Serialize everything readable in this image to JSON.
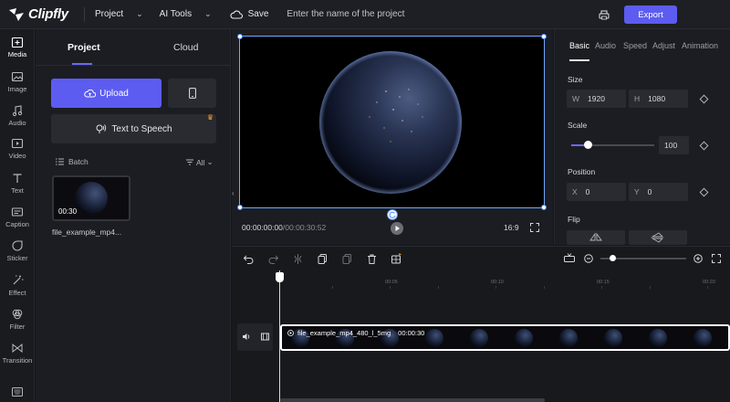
{
  "app": {
    "logo_text": "Clipfly",
    "project_menu": "Project",
    "ai_tools_menu": "AI Tools",
    "save_label": "Save",
    "project_name_placeholder": "Enter the name of the project",
    "export_label": "Export"
  },
  "rail": {
    "items": [
      {
        "label": "Media",
        "icon": "media-icon"
      },
      {
        "label": "Image",
        "icon": "image-icon"
      },
      {
        "label": "Audio",
        "icon": "music-icon"
      },
      {
        "label": "Video",
        "icon": "video-icon"
      },
      {
        "label": "Text",
        "icon": "text-icon"
      },
      {
        "label": "Caption",
        "icon": "caption-icon"
      },
      {
        "label": "Sticker",
        "icon": "sticker-icon"
      },
      {
        "label": "Effect",
        "icon": "effect-icon"
      },
      {
        "label": "Filter",
        "icon": "filter-icon"
      },
      {
        "label": "Transition",
        "icon": "transition-icon"
      }
    ]
  },
  "media": {
    "tab_project": "Project",
    "tab_cloud": "Cloud",
    "upload_label": "Upload",
    "tts_label": "Text to Speech",
    "batch_label": "Batch",
    "filter_label": "All",
    "item": {
      "duration": "00:30",
      "name": "file_example_mp4..."
    }
  },
  "preview": {
    "current_time": "00:00:00:00",
    "separator": "/",
    "total_time": "00:00:30:52",
    "aspect_ratio": "16:9"
  },
  "properties": {
    "tabs": [
      "Basic",
      "Audio",
      "Speed",
      "Adjust",
      "Animation"
    ],
    "size_label": "Size",
    "width_key": "W",
    "width_value": "1920",
    "height_key": "H",
    "height_value": "1080",
    "scale_label": "Scale",
    "scale_value": "100",
    "position_label": "Position",
    "x_key": "X",
    "x_value": "0",
    "y_key": "Y",
    "y_value": "0",
    "flip_label": "Flip"
  },
  "timeline": {
    "ruler_labels": [
      "00:05",
      "00:10",
      "00:15",
      "00:20"
    ],
    "clip_name": "file_example_mp4_480_l_5mg",
    "clip_duration": "00:00:30",
    "zoom_level": 0.14
  },
  "colors": {
    "accent": "#5d5cf0",
    "background": "#16171b",
    "panel": "#1c1d22",
    "crown": "#f59e2a"
  }
}
